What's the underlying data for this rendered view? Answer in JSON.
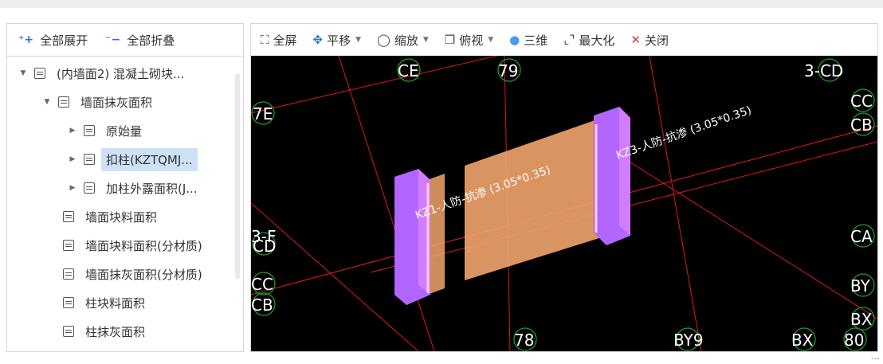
{
  "tree_toolbar": {
    "expand_all": "全部展开",
    "collapse_all": "全部折叠"
  },
  "tree": {
    "items": [
      {
        "label": "(内墙面2) 混凝土砌块...",
        "arrow": "down",
        "level": 0
      },
      {
        "label": "墙面抹灰面积",
        "arrow": "down",
        "level": 1
      },
      {
        "label": "原始量",
        "arrow": "right",
        "level": 2
      },
      {
        "label": "扣柱(KZTQMJ...",
        "arrow": "right",
        "level": 2,
        "selected": true
      },
      {
        "label": "加柱外露面积(J...",
        "arrow": "right",
        "level": 2
      },
      {
        "label": "墙面块料面积",
        "arrow": "none",
        "level": 1
      },
      {
        "label": "墙面块料面积(分材质)",
        "arrow": "none",
        "level": 1
      },
      {
        "label": "墙面抹灰面积(分材质)",
        "arrow": "none",
        "level": 1
      },
      {
        "label": "柱块料面积",
        "arrow": "none",
        "level": 1
      },
      {
        "label": "柱抹灰面积",
        "arrow": "none",
        "level": 1
      }
    ]
  },
  "viewer_toolbar": {
    "fullscreen": "全屏",
    "pan": "平移",
    "zoom": "缩放",
    "view": "俯视",
    "three_d": "三维",
    "maximize": "最大化",
    "close": "关闭"
  },
  "scene": {
    "axis_labels": [
      "CE",
      "79",
      "3-CD",
      "7E",
      "CC",
      "CB",
      "CA",
      "3-F",
      "CD",
      "CC",
      "CB",
      "BY",
      "BX",
      "78",
      "BY9",
      "BX",
      "80"
    ],
    "column_left_label": "KZ1-人防-抗渗 (3.05*0.35)",
    "column_right_label": "KZ3-人防-抗渗 (3.05*0.35)",
    "colors": {
      "background": "#000000",
      "grid_line": "#e01919",
      "axis_circle": "#1f9e2a",
      "column": "#b266ff",
      "wall": "#f2a46b",
      "accent": "#2b6fd4"
    }
  }
}
